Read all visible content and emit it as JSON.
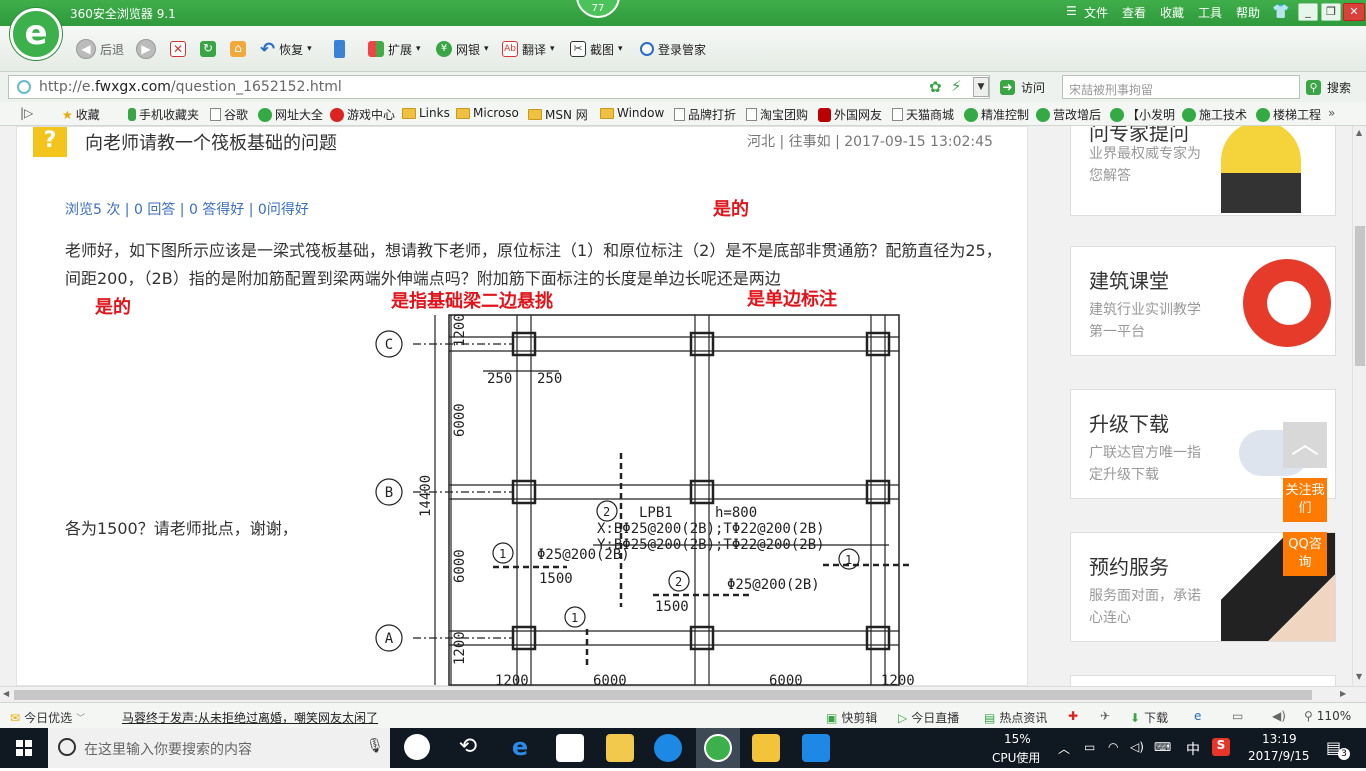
{
  "browser": {
    "title": "360安全浏览器 9.1",
    "badge": "77",
    "menus": [
      "文件",
      "查看",
      "收藏",
      "工具",
      "帮助"
    ],
    "logo_char": "e"
  },
  "toolbar": {
    "back": "后退",
    "restore": "恢复",
    "extend": "扩展",
    "bank": "网银",
    "translate": "翻译",
    "screenshot": "截图",
    "login": "登录管家"
  },
  "address": {
    "url_prefix": "http://e.",
    "url_domain": "fwxgx.com",
    "url_path": "/question_1652152.html",
    "go": "访问",
    "search_placeholder": "宋喆被刑事拘留",
    "search_btn": "搜索"
  },
  "bookmarks": [
    "收藏",
    "手机收藏夹",
    "谷歌",
    "网址大全",
    "游戏中心",
    "Links",
    "Microso",
    "MSN 网",
    "Window",
    "品牌打折",
    "淘宝团购",
    "外国网友",
    "天猫商城",
    "精准控制",
    "营改增后",
    "【小发明",
    "施工技术",
    "楼梯工程"
  ],
  "question": {
    "icon": "?",
    "title": "向老师请教一个筏板基础的问题",
    "meta": "河北 | 往事如 | 2017-09-15 13:02:45",
    "stats": "浏览5 次 | 0 回答 | 0 答得好 | 0问得好",
    "body1": "老师好，如下图所示应该是一梁式筏板基础，想请教下老师，原位标注（1）和原位标注（2）是不是底部非贯通筋？配筋直径为25，间距200，（2B）指的是附加筋配置到梁两端外伸端点吗？附加筋下面标注的长度是单边长呢还是两边",
    "body2": "各为1500？请老师批点，谢谢，"
  },
  "answers": {
    "a1": "是的",
    "a2": "是的",
    "a3": "是指基础梁二边悬挑",
    "a4": "是单边标注"
  },
  "drawing": {
    "axes": [
      "C",
      "B",
      "A"
    ],
    "row_dims": [
      "1200",
      "6000",
      "6000",
      "1200"
    ],
    "total": "14400",
    "col_dims": [
      "1200",
      "6000",
      "6000",
      "1200"
    ],
    "w250a": "250",
    "w250b": "250",
    "lpb": "LPB1",
    "h": "h=800",
    "xline": "X:BΦ25@200(2B);TΦ22@200(2B)",
    "yline": "Y:BΦ25@200(2B);TΦ22@200(2B)",
    "rebar1": "Φ25@200(2B)",
    "rebar2": "Φ25@200(2B)",
    "len1": "1500",
    "len2": "1500",
    "mark1": "1",
    "mark2": "2"
  },
  "sidebar": {
    "cards": [
      {
        "title": "问专家提问",
        "sub": "业界最权威专家为您解答"
      },
      {
        "title": "建筑课堂",
        "sub": "建筑行业实训教学第一平台"
      },
      {
        "title": "升级下载",
        "sub": "广联达官方唯一指定升级下载"
      },
      {
        "title": "预约服务",
        "sub": "服务面对面，承诺心连心"
      }
    ],
    "follow": "关注我们",
    "qq": "QQ咨询"
  },
  "status": {
    "today": "今日优选",
    "news": "马蓉终于发声:从未拒绝过离婚，嘲笑网友太闲了",
    "clip": "快剪辑",
    "live": "今日直播",
    "hot": "热点资讯",
    "download": "下载",
    "zoom": "110%"
  },
  "taskbar": {
    "search": "在这里输入你要搜索的内容",
    "cpu_pct": "15%",
    "cpu_label": "CPU使用",
    "ime": "中",
    "time": "13:19",
    "date": "2017/9/15",
    "notif": "3"
  }
}
